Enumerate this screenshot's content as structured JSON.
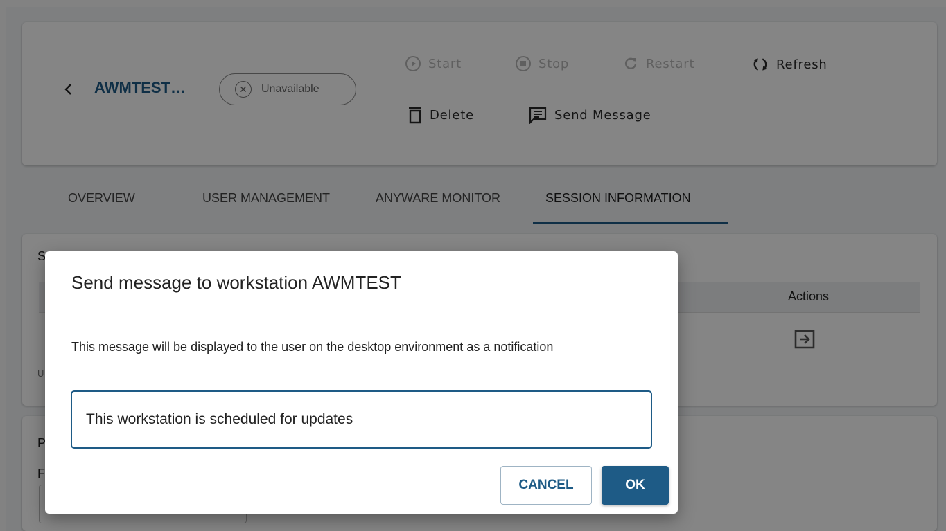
{
  "header": {
    "workstation_name": "AWMTEST…",
    "status": "Unavailable",
    "actions": {
      "start": "Start",
      "stop": "Stop",
      "restart": "Restart",
      "refresh": "Refresh",
      "delete": "Delete",
      "send_message": "Send Message"
    }
  },
  "tabs": [
    {
      "label": "OVERVIEW"
    },
    {
      "label": "USER MANAGEMENT"
    },
    {
      "label": "ANYWARE MONITOR"
    },
    {
      "label": "SESSION INFORMATION",
      "active": true
    }
  ],
  "background": {
    "card1_peek": "S",
    "card1_small_peek": "U",
    "table_actions_header": "Actions",
    "card2_peek_1": "P",
    "card2_peek_2": "F"
  },
  "dialog": {
    "title": "Send message to workstation AWMTEST",
    "description": "This message will be displayed to the user on the desktop environment as a notification",
    "message_value": "This workstation is scheduled for updates",
    "cancel_label": "CANCEL",
    "ok_label": "OK"
  },
  "colors": {
    "accent": "#1e5b86",
    "disabled": "#b7b7b7"
  }
}
